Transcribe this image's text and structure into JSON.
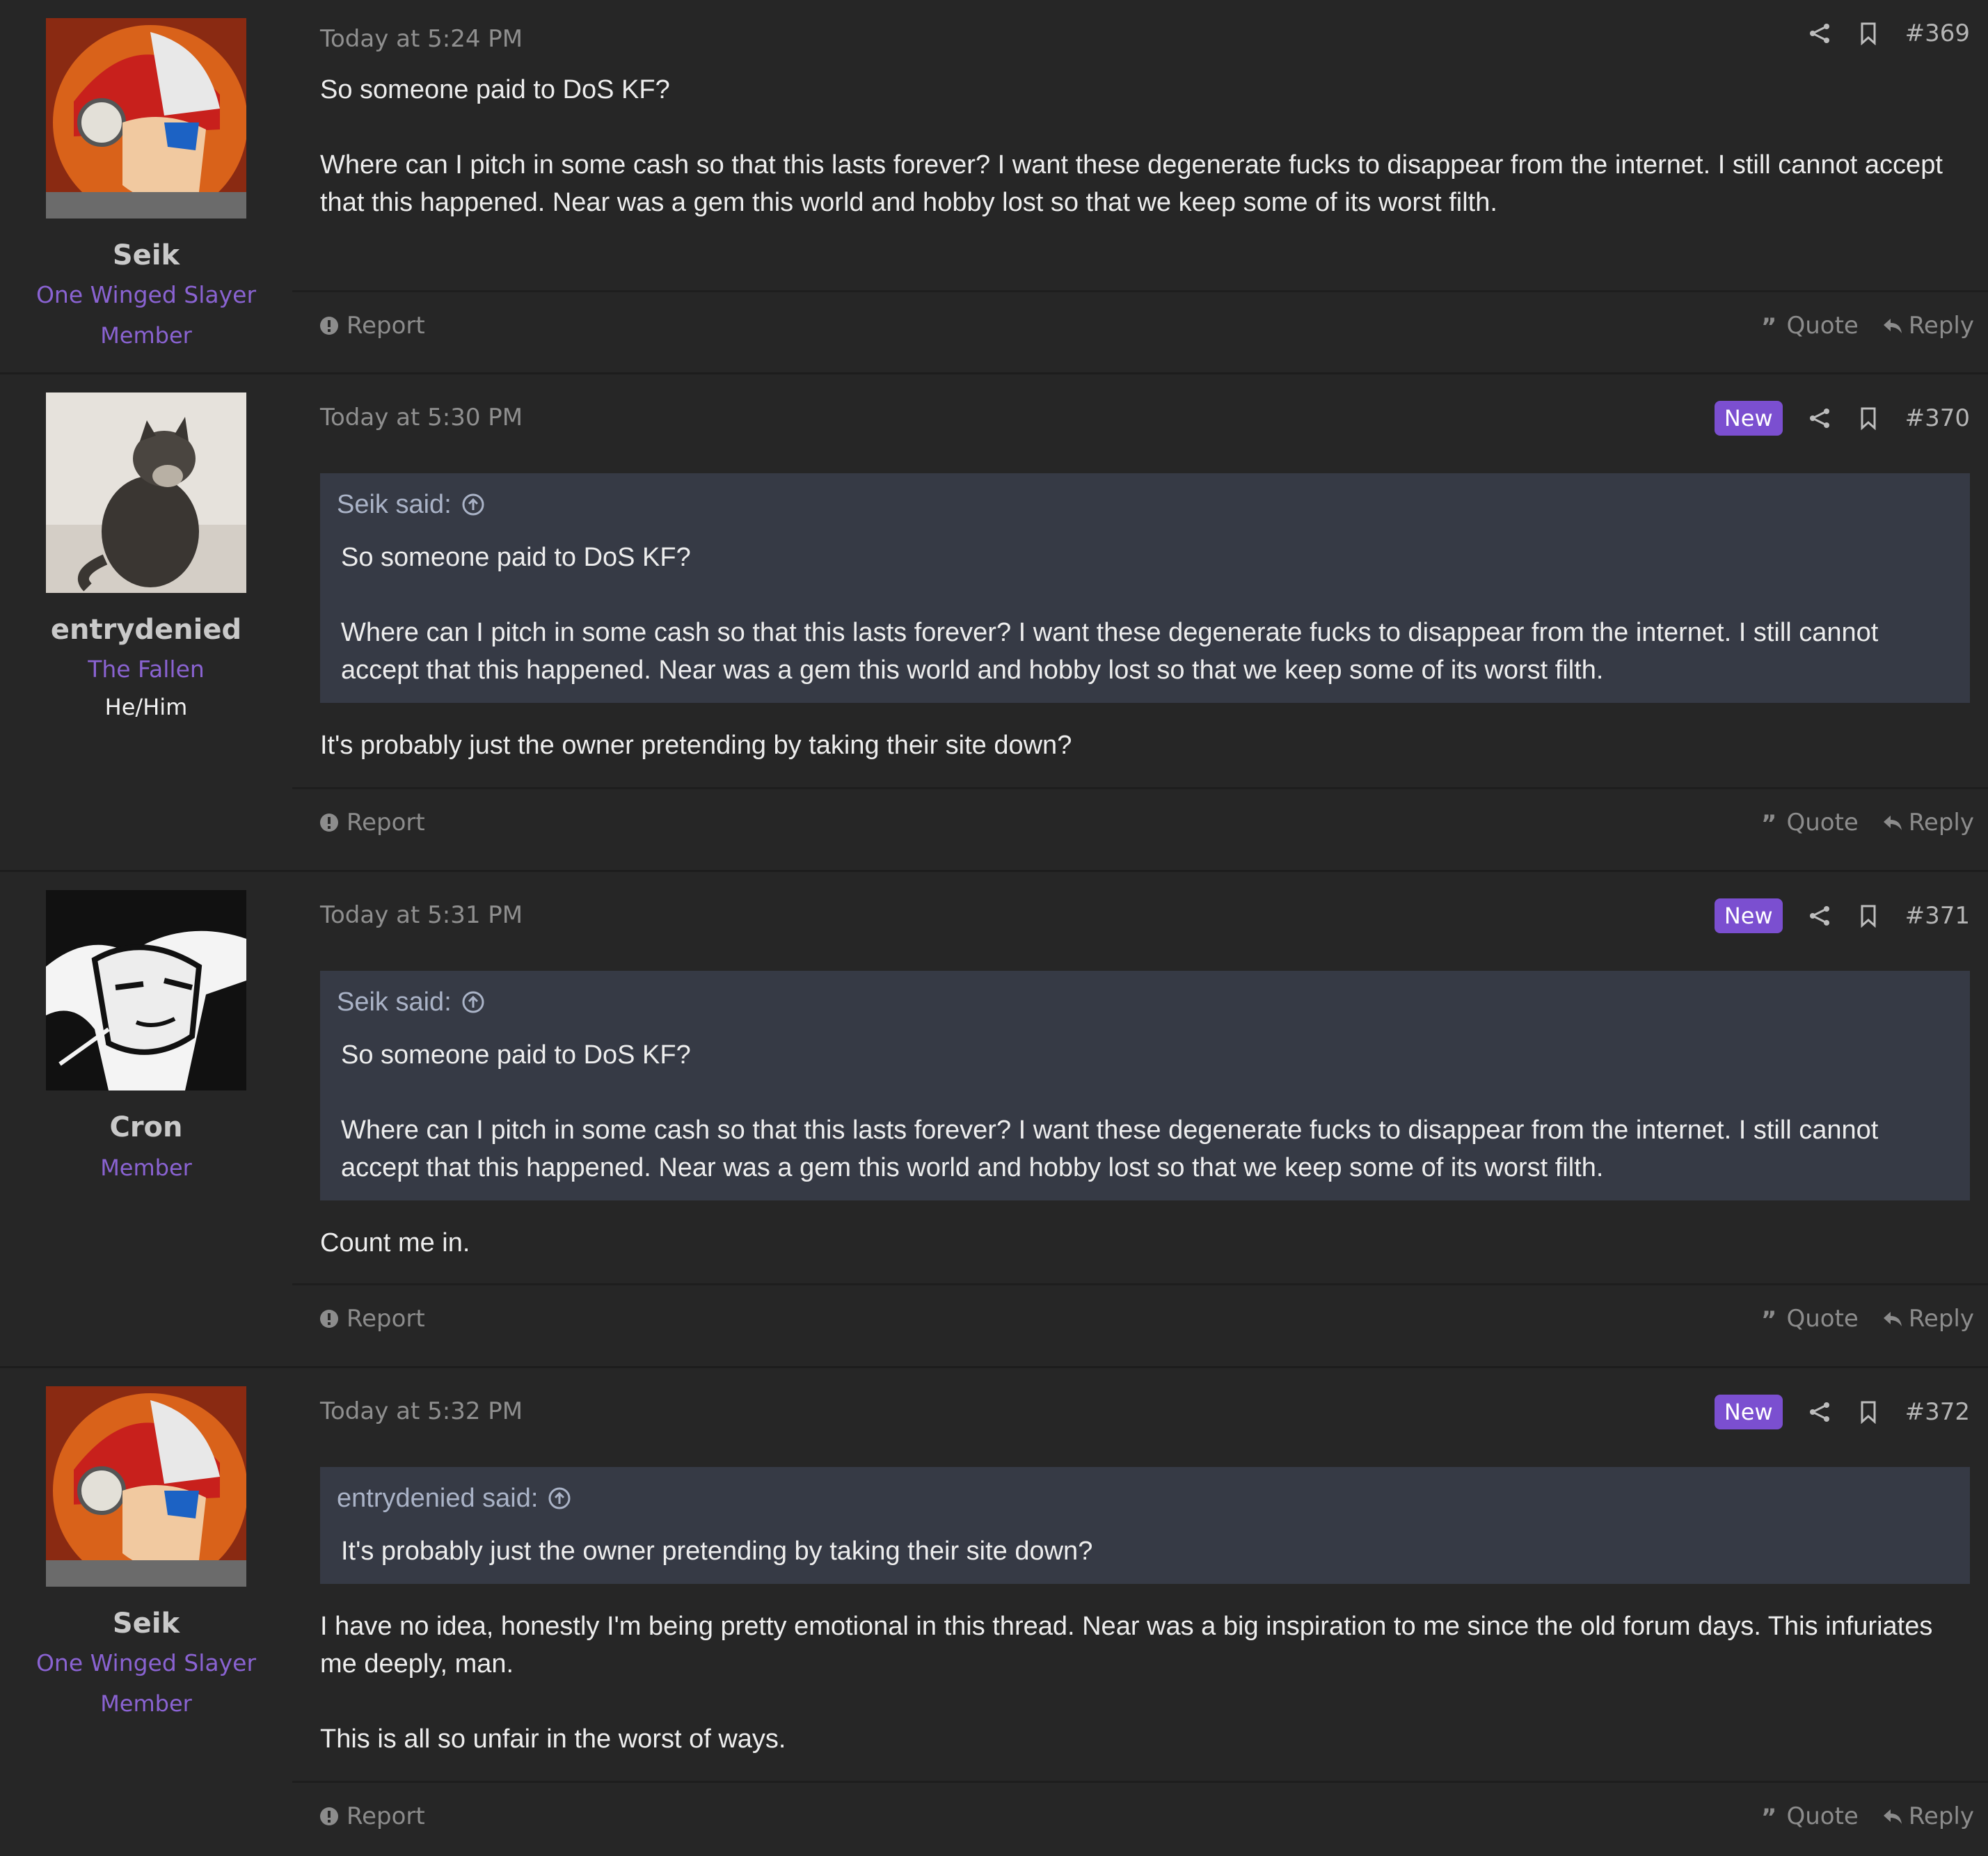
{
  "posts": [
    {
      "author": "Seik",
      "title": "One Winged Slayer",
      "role": "Member",
      "pronouns": "",
      "avatar": "mega-man-x-avatar",
      "time": "Today at 5:24 PM",
      "number": "#369",
      "is_new": false,
      "quote": null,
      "body": [
        "So someone paid to DoS KF?",
        "Where can I pitch in some cash so that this lasts forever? I want these degenerate fucks to disappear from the internet. I still cannot accept that this happened. Near was a gem this world and hobby lost so that we keep some of its worst filth."
      ]
    },
    {
      "author": "entrydenied",
      "title": "The Fallen",
      "role": "",
      "pronouns": "He/Him",
      "avatar": "cat-photo-avatar",
      "time": "Today at 5:30 PM",
      "number": "#370",
      "is_new": true,
      "quote": {
        "header": "Seik said:",
        "lines": [
          "So someone paid to DoS KF?",
          "Where can I pitch in some cash so that this lasts forever? I want these degenerate fucks to disappear from the internet. I still cannot accept that this happened. Near was a gem this world and hobby lost so that we keep some of its worst filth."
        ]
      },
      "body": [
        "It's probably just the owner pretending by taking their site down?"
      ]
    },
    {
      "author": "Cron",
      "title": "",
      "role": "Member",
      "pronouns": "",
      "avatar": "spike-manga-avatar",
      "time": "Today at 5:31 PM",
      "number": "#371",
      "is_new": true,
      "quote": {
        "header": "Seik said:",
        "lines": [
          "So someone paid to DoS KF?",
          "Where can I pitch in some cash so that this lasts forever? I want these degenerate fucks to disappear from the internet. I still cannot accept that this happened. Near was a gem this world and hobby lost so that we keep some of its worst filth."
        ]
      },
      "body": [
        "Count me in."
      ]
    },
    {
      "author": "Seik",
      "title": "One Winged Slayer",
      "role": "Member",
      "pronouns": "",
      "avatar": "mega-man-x-avatar",
      "time": "Today at 5:32 PM",
      "number": "#372",
      "is_new": true,
      "quote": {
        "header": "entrydenied said:",
        "lines": [
          "It's probably just the owner pretending by taking their site down?"
        ]
      },
      "body": [
        "I have no idea, honestly I'm being pretty emotional in this thread. Near was a big inspiration to me since the old forum days. This infuriates me deeply, man.",
        "This is all so unfair in the worst of ways."
      ]
    }
  ],
  "labels": {
    "new": "New",
    "report": "Report",
    "quote": "Quote",
    "reply": "Reply"
  },
  "icons": [
    "share-icon",
    "bookmark-icon",
    "report-icon",
    "quote-icon",
    "reply-icon",
    "jump-to-quote-icon"
  ],
  "colors": {
    "background": "#262626",
    "accent": "#8a63d2",
    "badge": "#7b4fd0",
    "quote_bg": "#363a45"
  }
}
